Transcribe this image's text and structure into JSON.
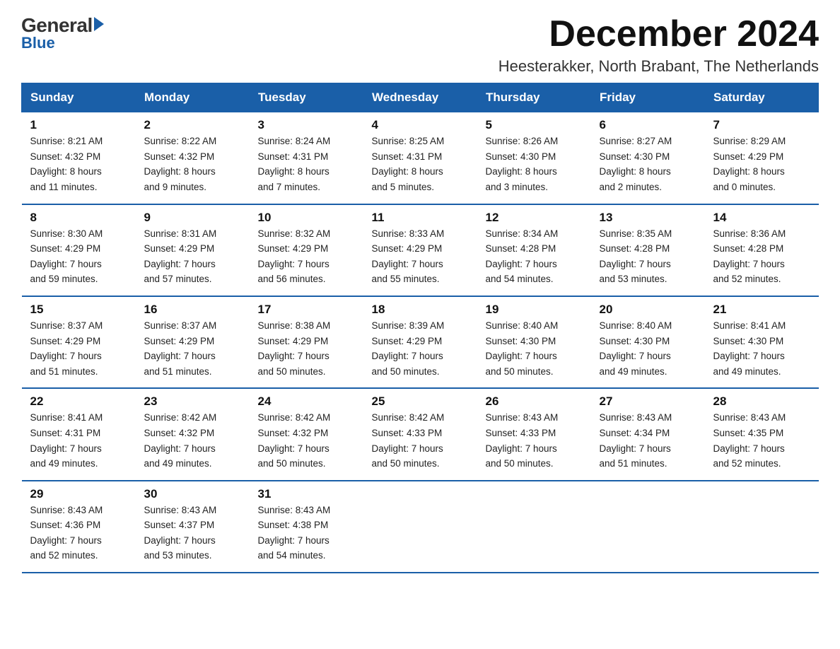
{
  "logo": {
    "general": "General",
    "blue": "Blue"
  },
  "title": "December 2024",
  "subtitle": "Heesterakker, North Brabant, The Netherlands",
  "days_of_week": [
    "Sunday",
    "Monday",
    "Tuesday",
    "Wednesday",
    "Thursday",
    "Friday",
    "Saturday"
  ],
  "weeks": [
    [
      {
        "num": "1",
        "info": "Sunrise: 8:21 AM\nSunset: 4:32 PM\nDaylight: 8 hours\nand 11 minutes."
      },
      {
        "num": "2",
        "info": "Sunrise: 8:22 AM\nSunset: 4:32 PM\nDaylight: 8 hours\nand 9 minutes."
      },
      {
        "num": "3",
        "info": "Sunrise: 8:24 AM\nSunset: 4:31 PM\nDaylight: 8 hours\nand 7 minutes."
      },
      {
        "num": "4",
        "info": "Sunrise: 8:25 AM\nSunset: 4:31 PM\nDaylight: 8 hours\nand 5 minutes."
      },
      {
        "num": "5",
        "info": "Sunrise: 8:26 AM\nSunset: 4:30 PM\nDaylight: 8 hours\nand 3 minutes."
      },
      {
        "num": "6",
        "info": "Sunrise: 8:27 AM\nSunset: 4:30 PM\nDaylight: 8 hours\nand 2 minutes."
      },
      {
        "num": "7",
        "info": "Sunrise: 8:29 AM\nSunset: 4:29 PM\nDaylight: 8 hours\nand 0 minutes."
      }
    ],
    [
      {
        "num": "8",
        "info": "Sunrise: 8:30 AM\nSunset: 4:29 PM\nDaylight: 7 hours\nand 59 minutes."
      },
      {
        "num": "9",
        "info": "Sunrise: 8:31 AM\nSunset: 4:29 PM\nDaylight: 7 hours\nand 57 minutes."
      },
      {
        "num": "10",
        "info": "Sunrise: 8:32 AM\nSunset: 4:29 PM\nDaylight: 7 hours\nand 56 minutes."
      },
      {
        "num": "11",
        "info": "Sunrise: 8:33 AM\nSunset: 4:29 PM\nDaylight: 7 hours\nand 55 minutes."
      },
      {
        "num": "12",
        "info": "Sunrise: 8:34 AM\nSunset: 4:28 PM\nDaylight: 7 hours\nand 54 minutes."
      },
      {
        "num": "13",
        "info": "Sunrise: 8:35 AM\nSunset: 4:28 PM\nDaylight: 7 hours\nand 53 minutes."
      },
      {
        "num": "14",
        "info": "Sunrise: 8:36 AM\nSunset: 4:28 PM\nDaylight: 7 hours\nand 52 minutes."
      }
    ],
    [
      {
        "num": "15",
        "info": "Sunrise: 8:37 AM\nSunset: 4:29 PM\nDaylight: 7 hours\nand 51 minutes."
      },
      {
        "num": "16",
        "info": "Sunrise: 8:37 AM\nSunset: 4:29 PM\nDaylight: 7 hours\nand 51 minutes."
      },
      {
        "num": "17",
        "info": "Sunrise: 8:38 AM\nSunset: 4:29 PM\nDaylight: 7 hours\nand 50 minutes."
      },
      {
        "num": "18",
        "info": "Sunrise: 8:39 AM\nSunset: 4:29 PM\nDaylight: 7 hours\nand 50 minutes."
      },
      {
        "num": "19",
        "info": "Sunrise: 8:40 AM\nSunset: 4:30 PM\nDaylight: 7 hours\nand 50 minutes."
      },
      {
        "num": "20",
        "info": "Sunrise: 8:40 AM\nSunset: 4:30 PM\nDaylight: 7 hours\nand 49 minutes."
      },
      {
        "num": "21",
        "info": "Sunrise: 8:41 AM\nSunset: 4:30 PM\nDaylight: 7 hours\nand 49 minutes."
      }
    ],
    [
      {
        "num": "22",
        "info": "Sunrise: 8:41 AM\nSunset: 4:31 PM\nDaylight: 7 hours\nand 49 minutes."
      },
      {
        "num": "23",
        "info": "Sunrise: 8:42 AM\nSunset: 4:32 PM\nDaylight: 7 hours\nand 49 minutes."
      },
      {
        "num": "24",
        "info": "Sunrise: 8:42 AM\nSunset: 4:32 PM\nDaylight: 7 hours\nand 50 minutes."
      },
      {
        "num": "25",
        "info": "Sunrise: 8:42 AM\nSunset: 4:33 PM\nDaylight: 7 hours\nand 50 minutes."
      },
      {
        "num": "26",
        "info": "Sunrise: 8:43 AM\nSunset: 4:33 PM\nDaylight: 7 hours\nand 50 minutes."
      },
      {
        "num": "27",
        "info": "Sunrise: 8:43 AM\nSunset: 4:34 PM\nDaylight: 7 hours\nand 51 minutes."
      },
      {
        "num": "28",
        "info": "Sunrise: 8:43 AM\nSunset: 4:35 PM\nDaylight: 7 hours\nand 52 minutes."
      }
    ],
    [
      {
        "num": "29",
        "info": "Sunrise: 8:43 AM\nSunset: 4:36 PM\nDaylight: 7 hours\nand 52 minutes."
      },
      {
        "num": "30",
        "info": "Sunrise: 8:43 AM\nSunset: 4:37 PM\nDaylight: 7 hours\nand 53 minutes."
      },
      {
        "num": "31",
        "info": "Sunrise: 8:43 AM\nSunset: 4:38 PM\nDaylight: 7 hours\nand 54 minutes."
      },
      {
        "num": "",
        "info": ""
      },
      {
        "num": "",
        "info": ""
      },
      {
        "num": "",
        "info": ""
      },
      {
        "num": "",
        "info": ""
      }
    ]
  ]
}
